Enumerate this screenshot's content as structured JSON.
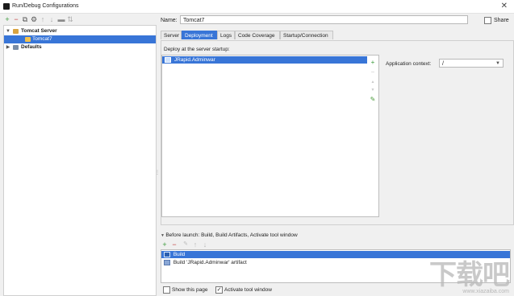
{
  "window": {
    "title": "Run/Debug Configurations",
    "close_glyph": "✕"
  },
  "left_toolbar": {
    "icons": [
      "add-icon",
      "remove-icon",
      "copy-icon",
      "wrench-icon",
      "move-up-icon",
      "move-down-icon",
      "folder-icon",
      "sort-icon"
    ],
    "glyphs": [
      "+",
      "−",
      "⧉",
      "⚙",
      "↑",
      "↓",
      "▬",
      "⇅"
    ]
  },
  "tree": {
    "items": [
      {
        "label": "Tomcat Server",
        "expanded": true
      },
      {
        "label": "Tomcat7",
        "selected": true
      },
      {
        "label": "Defaults",
        "expanded": false
      }
    ]
  },
  "name": {
    "label": "Name:",
    "value": "Tomcat7"
  },
  "share": {
    "label": "Share",
    "checked": false
  },
  "tabs": [
    "Server",
    "Deployment",
    "Logs",
    "Code Coverage",
    "Startup/Connection"
  ],
  "active_tab": "Deployment",
  "deployment": {
    "heading": "Deploy at the server startup:",
    "items": [
      "JRapid.Adminwar"
    ],
    "side_tools": [
      "+",
      "−",
      "▲",
      "▼",
      "✎"
    ]
  },
  "app_context": {
    "label": "Application context:",
    "value": "/"
  },
  "before_launch": {
    "heading": "Before launch: Build, Build Artifacts, Activate tool window",
    "toolbar": [
      "+",
      "−",
      "✎",
      "↑",
      "↓"
    ],
    "items": [
      {
        "label": "Build",
        "selected": true
      },
      {
        "label": "Build 'JRapid.Adminwar' artifact",
        "selected": false
      }
    ]
  },
  "show_page": {
    "label": "Show this page",
    "checked": false
  },
  "activate_tool": {
    "label": "Activate tool window",
    "checked": true
  },
  "watermark": {
    "big": "下载吧",
    "small": "www.xiazaiba.com"
  }
}
